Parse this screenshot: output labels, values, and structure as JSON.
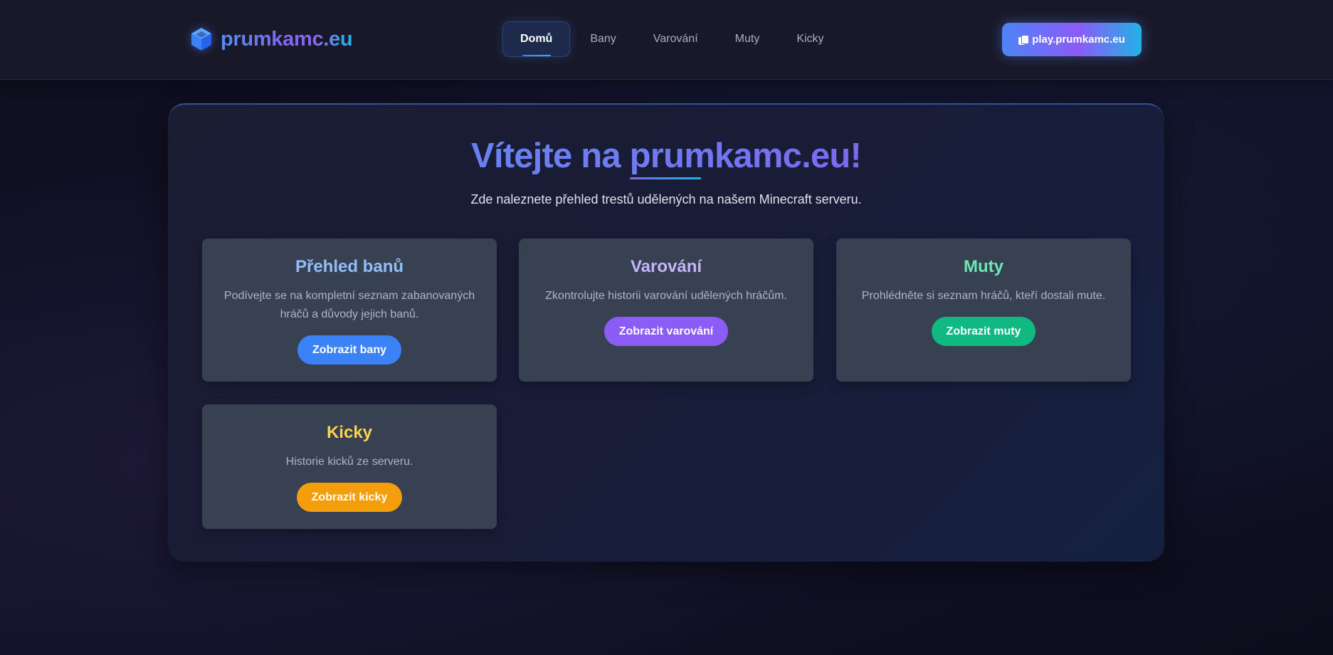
{
  "header": {
    "logo_text": "prumkamc.eu",
    "nav": [
      {
        "label": "Domů",
        "active": true
      },
      {
        "label": "Bany",
        "active": false
      },
      {
        "label": "Varování",
        "active": false
      },
      {
        "label": "Muty",
        "active": false
      },
      {
        "label": "Kicky",
        "active": false
      }
    ],
    "play_button": "play.prumkamc.eu"
  },
  "hero": {
    "title": "Vítejte na prumkamc.eu!",
    "subtitle": "Zde naleznete přehled trestů udělených na našem Minecraft serveru."
  },
  "features": [
    {
      "title": "Přehled banů",
      "description": "Podívejte se na kompletní seznam zabanovaných hráčů a důvody jejich banů.",
      "button": "Zobrazit bany",
      "color": "#3b82f6"
    },
    {
      "title": "Varování",
      "description": "Zkontrolujte historii varování udělených hráčům.",
      "button": "Zobrazit varování",
      "color": "#8b5cf6"
    },
    {
      "title": "Muty",
      "description": "Prohlédněte si seznam hráčů, kteří dostali mute.",
      "button": "Zobrazit muty",
      "color": "#10b981"
    },
    {
      "title": "Kicky",
      "description": "Historie kicků ze serveru.",
      "button": "Zobrazit kicky",
      "color": "#f59e0b"
    }
  ],
  "icons": {
    "logo": "cube-icon",
    "play": "copy-icon"
  }
}
